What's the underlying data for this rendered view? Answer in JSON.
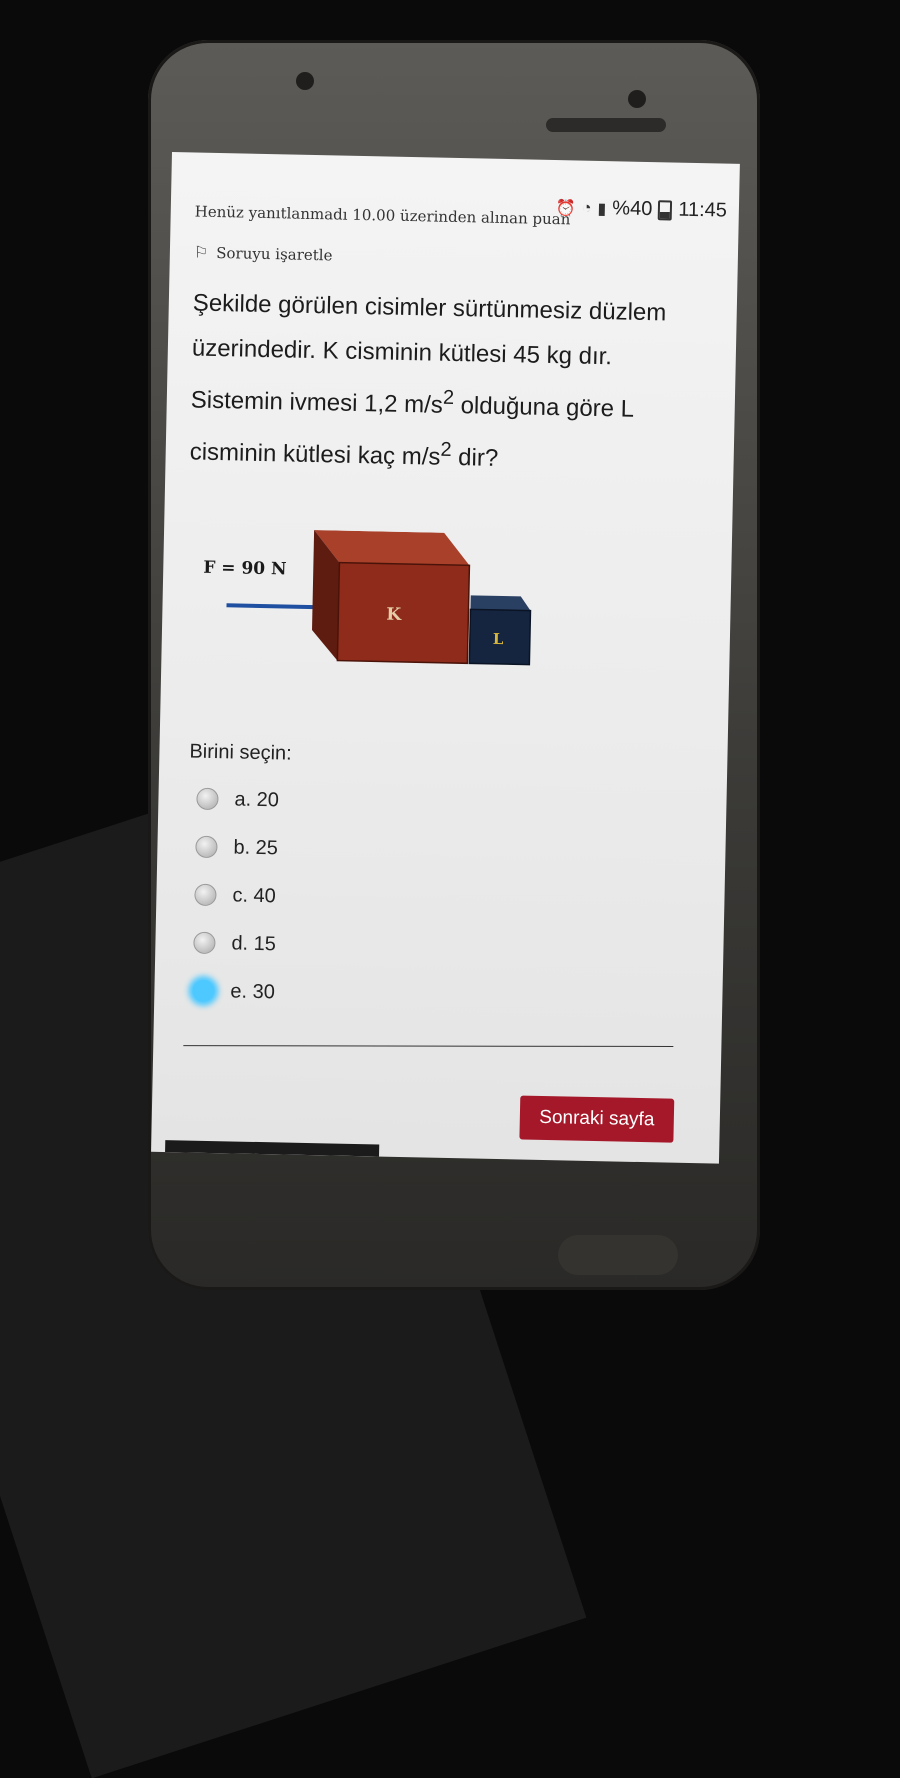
{
  "status_bar": {
    "battery": "%40",
    "time": "11:45",
    "icons": [
      "alarm-icon",
      "wifi-icon",
      "signal-icon",
      "battery-icon"
    ]
  },
  "question": {
    "info": "Henüz yanıtlanmadı  10.00 üzerinden alınan puan",
    "flag_label": "Soruyu işaretle",
    "text": {
      "part1": "Şekilde görülen cisimler sürtünmesiz düzlem üzerindedir. K cisminin kütlesi 45 kg dır. Sistemin ivmesi 1,2 m/s",
      "sup1": "2",
      "part2": " olduğuna göre L cisminin kütlesi kaç m/s",
      "sup2": "2",
      "part3": " dir?"
    }
  },
  "diagram": {
    "force_label": "F = 90 N",
    "block_k_label": "K",
    "block_l_label": "L",
    "colors": {
      "block_k": "#8e2b1a",
      "block_l": "#15253f",
      "arrow": "#1e4fa0",
      "label_l": "#d8b73a"
    }
  },
  "answers": {
    "prompt": "Birini seçin:",
    "options": [
      {
        "label": "a. 20",
        "selected": false
      },
      {
        "label": "b. 25",
        "selected": false
      },
      {
        "label": "c. 40",
        "selected": false
      },
      {
        "label": "d. 15",
        "selected": false
      },
      {
        "label": "e. 30",
        "selected": true
      }
    ]
  },
  "navigation": {
    "next_label": "Sonraki sayfa"
  },
  "colors": {
    "accent": "#a5182a",
    "selection_highlight": "#4ec9ff"
  }
}
